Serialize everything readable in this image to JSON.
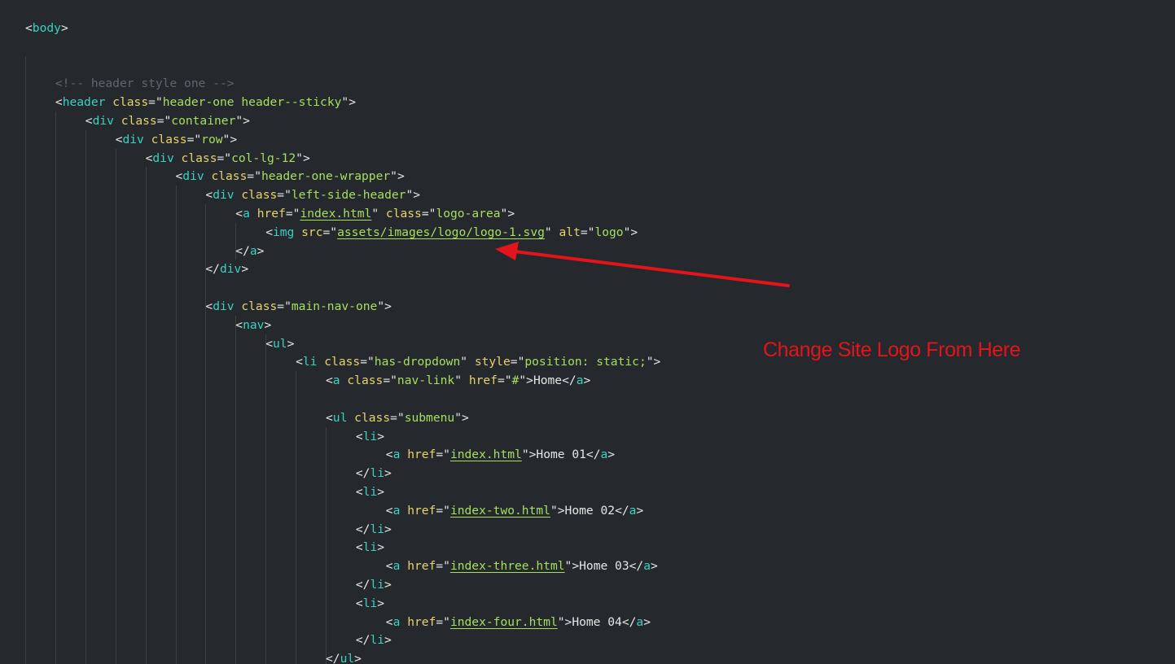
{
  "editor": {
    "lines": [
      {
        "row": 0,
        "indent": 0,
        "tokens": [
          [
            "p",
            "<"
          ],
          [
            "t",
            "body"
          ],
          [
            "p",
            ">"
          ]
        ]
      },
      {
        "row": 3,
        "indent": 1,
        "tokens": [
          [
            "c",
            "<!-- header style one -->"
          ]
        ]
      },
      {
        "row": 4,
        "indent": 1,
        "tokens": [
          [
            "p",
            "<"
          ],
          [
            "t",
            "header"
          ],
          [
            "w",
            " "
          ],
          [
            "a",
            "class"
          ],
          [
            "p",
            "="
          ],
          [
            "p",
            "\""
          ],
          [
            "s",
            "header-one header--sticky"
          ],
          [
            "p",
            "\""
          ],
          [
            "p",
            ">"
          ]
        ]
      },
      {
        "row": 5,
        "indent": 2,
        "tokens": [
          [
            "p",
            "<"
          ],
          [
            "t",
            "div"
          ],
          [
            "w",
            " "
          ],
          [
            "a",
            "class"
          ],
          [
            "p",
            "="
          ],
          [
            "p",
            "\""
          ],
          [
            "s",
            "container"
          ],
          [
            "p",
            "\""
          ],
          [
            "p",
            ">"
          ]
        ]
      },
      {
        "row": 6,
        "indent": 3,
        "tokens": [
          [
            "p",
            "<"
          ],
          [
            "t",
            "div"
          ],
          [
            "w",
            " "
          ],
          [
            "a",
            "class"
          ],
          [
            "p",
            "="
          ],
          [
            "p",
            "\""
          ],
          [
            "s",
            "row"
          ],
          [
            "p",
            "\""
          ],
          [
            "p",
            ">"
          ]
        ]
      },
      {
        "row": 7,
        "indent": 4,
        "tokens": [
          [
            "p",
            "<"
          ],
          [
            "t",
            "div"
          ],
          [
            "w",
            " "
          ],
          [
            "a",
            "class"
          ],
          [
            "p",
            "="
          ],
          [
            "p",
            "\""
          ],
          [
            "s",
            "col-lg-12"
          ],
          [
            "p",
            "\""
          ],
          [
            "p",
            ">"
          ]
        ]
      },
      {
        "row": 8,
        "indent": 5,
        "tokens": [
          [
            "p",
            "<"
          ],
          [
            "t",
            "div"
          ],
          [
            "w",
            " "
          ],
          [
            "a",
            "class"
          ],
          [
            "p",
            "="
          ],
          [
            "p",
            "\""
          ],
          [
            "s",
            "header-one-wrapper"
          ],
          [
            "p",
            "\""
          ],
          [
            "p",
            ">"
          ]
        ]
      },
      {
        "row": 9,
        "indent": 6,
        "tokens": [
          [
            "p",
            "<"
          ],
          [
            "t",
            "div"
          ],
          [
            "w",
            " "
          ],
          [
            "a",
            "class"
          ],
          [
            "p",
            "="
          ],
          [
            "p",
            "\""
          ],
          [
            "s",
            "left-side-header"
          ],
          [
            "p",
            "\""
          ],
          [
            "p",
            ">"
          ]
        ]
      },
      {
        "row": 10,
        "indent": 7,
        "tokens": [
          [
            "p",
            "<"
          ],
          [
            "t",
            "a"
          ],
          [
            "w",
            " "
          ],
          [
            "a",
            "href"
          ],
          [
            "p",
            "="
          ],
          [
            "p",
            "\""
          ],
          [
            "l",
            "index.html"
          ],
          [
            "p",
            "\""
          ],
          [
            "w",
            " "
          ],
          [
            "a",
            "class"
          ],
          [
            "p",
            "="
          ],
          [
            "p",
            "\""
          ],
          [
            "s",
            "logo-area"
          ],
          [
            "p",
            "\""
          ],
          [
            "p",
            ">"
          ]
        ]
      },
      {
        "row": 11,
        "indent": 8,
        "tokens": [
          [
            "p",
            "<"
          ],
          [
            "t",
            "img"
          ],
          [
            "w",
            " "
          ],
          [
            "a",
            "src"
          ],
          [
            "p",
            "="
          ],
          [
            "p",
            "\""
          ],
          [
            "l",
            "assets/images/logo/logo-1.svg"
          ],
          [
            "p",
            "\""
          ],
          [
            "w",
            " "
          ],
          [
            "a",
            "alt"
          ],
          [
            "p",
            "="
          ],
          [
            "p",
            "\""
          ],
          [
            "s",
            "logo"
          ],
          [
            "p",
            "\""
          ],
          [
            "p",
            ">"
          ]
        ]
      },
      {
        "row": 12,
        "indent": 7,
        "tokens": [
          [
            "p",
            "</"
          ],
          [
            "t",
            "a"
          ],
          [
            "p",
            ">"
          ]
        ]
      },
      {
        "row": 13,
        "indent": 6,
        "tokens": [
          [
            "p",
            "</"
          ],
          [
            "t",
            "div"
          ],
          [
            "p",
            ">"
          ]
        ]
      },
      {
        "row": 15,
        "indent": 6,
        "tokens": [
          [
            "p",
            "<"
          ],
          [
            "t",
            "div"
          ],
          [
            "w",
            " "
          ],
          [
            "a",
            "class"
          ],
          [
            "p",
            "="
          ],
          [
            "p",
            "\""
          ],
          [
            "s",
            "main-nav-one"
          ],
          [
            "p",
            "\""
          ],
          [
            "p",
            ">"
          ]
        ]
      },
      {
        "row": 16,
        "indent": 7,
        "tokens": [
          [
            "p",
            "<"
          ],
          [
            "t",
            "nav"
          ],
          [
            "p",
            ">"
          ]
        ]
      },
      {
        "row": 17,
        "indent": 8,
        "tokens": [
          [
            "p",
            "<"
          ],
          [
            "t",
            "ul"
          ],
          [
            "p",
            ">"
          ]
        ]
      },
      {
        "row": 18,
        "indent": 9,
        "tokens": [
          [
            "p",
            "<"
          ],
          [
            "t",
            "li"
          ],
          [
            "w",
            " "
          ],
          [
            "a",
            "class"
          ],
          [
            "p",
            "="
          ],
          [
            "p",
            "\""
          ],
          [
            "s",
            "has-dropdown"
          ],
          [
            "p",
            "\""
          ],
          [
            "w",
            " "
          ],
          [
            "a",
            "style"
          ],
          [
            "p",
            "="
          ],
          [
            "p",
            "\""
          ],
          [
            "s",
            "position: static;"
          ],
          [
            "p",
            "\""
          ],
          [
            "p",
            ">"
          ]
        ]
      },
      {
        "row": 19,
        "indent": 10,
        "tokens": [
          [
            "p",
            "<"
          ],
          [
            "t",
            "a"
          ],
          [
            "w",
            " "
          ],
          [
            "a",
            "class"
          ],
          [
            "p",
            "="
          ],
          [
            "p",
            "\""
          ],
          [
            "s",
            "nav-link"
          ],
          [
            "p",
            "\""
          ],
          [
            "w",
            " "
          ],
          [
            "a",
            "href"
          ],
          [
            "p",
            "="
          ],
          [
            "p",
            "\""
          ],
          [
            "s",
            "#"
          ],
          [
            "p",
            "\""
          ],
          [
            "p",
            ">"
          ],
          [
            "x",
            "Home"
          ],
          [
            "p",
            "</"
          ],
          [
            "t",
            "a"
          ],
          [
            "p",
            ">"
          ]
        ]
      },
      {
        "row": 21,
        "indent": 10,
        "tokens": [
          [
            "p",
            "<"
          ],
          [
            "t",
            "ul"
          ],
          [
            "w",
            " "
          ],
          [
            "a",
            "class"
          ],
          [
            "p",
            "="
          ],
          [
            "p",
            "\""
          ],
          [
            "s",
            "submenu"
          ],
          [
            "p",
            "\""
          ],
          [
            "p",
            ">"
          ]
        ]
      },
      {
        "row": 22,
        "indent": 11,
        "tokens": [
          [
            "p",
            "<"
          ],
          [
            "t",
            "li"
          ],
          [
            "p",
            ">"
          ]
        ]
      },
      {
        "row": 23,
        "indent": 12,
        "tokens": [
          [
            "p",
            "<"
          ],
          [
            "t",
            "a"
          ],
          [
            "w",
            " "
          ],
          [
            "a",
            "href"
          ],
          [
            "p",
            "="
          ],
          [
            "p",
            "\""
          ],
          [
            "l",
            "index.html"
          ],
          [
            "p",
            "\""
          ],
          [
            "p",
            ">"
          ],
          [
            "x",
            "Home 01"
          ],
          [
            "p",
            "</"
          ],
          [
            "t",
            "a"
          ],
          [
            "p",
            ">"
          ]
        ]
      },
      {
        "row": 24,
        "indent": 11,
        "tokens": [
          [
            "p",
            "</"
          ],
          [
            "t",
            "li"
          ],
          [
            "p",
            ">"
          ]
        ]
      },
      {
        "row": 25,
        "indent": 11,
        "tokens": [
          [
            "p",
            "<"
          ],
          [
            "t",
            "li"
          ],
          [
            "p",
            ">"
          ]
        ]
      },
      {
        "row": 26,
        "indent": 12,
        "tokens": [
          [
            "p",
            "<"
          ],
          [
            "t",
            "a"
          ],
          [
            "w",
            " "
          ],
          [
            "a",
            "href"
          ],
          [
            "p",
            "="
          ],
          [
            "p",
            "\""
          ],
          [
            "l",
            "index-two.html"
          ],
          [
            "p",
            "\""
          ],
          [
            "p",
            ">"
          ],
          [
            "x",
            "Home 02"
          ],
          [
            "p",
            "</"
          ],
          [
            "t",
            "a"
          ],
          [
            "p",
            ">"
          ]
        ]
      },
      {
        "row": 27,
        "indent": 11,
        "tokens": [
          [
            "p",
            "</"
          ],
          [
            "t",
            "li"
          ],
          [
            "p",
            ">"
          ]
        ]
      },
      {
        "row": 28,
        "indent": 11,
        "tokens": [
          [
            "p",
            "<"
          ],
          [
            "t",
            "li"
          ],
          [
            "p",
            ">"
          ]
        ]
      },
      {
        "row": 29,
        "indent": 12,
        "tokens": [
          [
            "p",
            "<"
          ],
          [
            "t",
            "a"
          ],
          [
            "w",
            " "
          ],
          [
            "a",
            "href"
          ],
          [
            "p",
            "="
          ],
          [
            "p",
            "\""
          ],
          [
            "l",
            "index-three.html"
          ],
          [
            "p",
            "\""
          ],
          [
            "p",
            ">"
          ],
          [
            "x",
            "Home 03"
          ],
          [
            "p",
            "</"
          ],
          [
            "t",
            "a"
          ],
          [
            "p",
            ">"
          ]
        ]
      },
      {
        "row": 30,
        "indent": 11,
        "tokens": [
          [
            "p",
            "</"
          ],
          [
            "t",
            "li"
          ],
          [
            "p",
            ">"
          ]
        ]
      },
      {
        "row": 31,
        "indent": 11,
        "tokens": [
          [
            "p",
            "<"
          ],
          [
            "t",
            "li"
          ],
          [
            "p",
            ">"
          ]
        ]
      },
      {
        "row": 32,
        "indent": 12,
        "tokens": [
          [
            "p",
            "<"
          ],
          [
            "t",
            "a"
          ],
          [
            "w",
            " "
          ],
          [
            "a",
            "href"
          ],
          [
            "p",
            "="
          ],
          [
            "p",
            "\""
          ],
          [
            "l",
            "index-four.html"
          ],
          [
            "p",
            "\""
          ],
          [
            "p",
            ">"
          ],
          [
            "x",
            "Home 04"
          ],
          [
            "p",
            "</"
          ],
          [
            "t",
            "a"
          ],
          [
            "p",
            ">"
          ]
        ]
      },
      {
        "row": 33,
        "indent": 11,
        "tokens": [
          [
            "p",
            "</"
          ],
          [
            "t",
            "li"
          ],
          [
            "p",
            ">"
          ]
        ]
      },
      {
        "row": 34,
        "indent": 10,
        "tokens": [
          [
            "p",
            "</"
          ],
          [
            "t",
            "ul"
          ],
          [
            "p",
            ">"
          ]
        ]
      }
    ]
  },
  "annotation": {
    "text": "Change Site Logo From Here",
    "color": "#e3141b"
  },
  "theme": {
    "background": "#25292d",
    "tag": "#3ad1c1",
    "attribute": "#e7d36b",
    "string": "#a7df5f",
    "comment": "#5d6670",
    "text": "#e6e6e6"
  }
}
